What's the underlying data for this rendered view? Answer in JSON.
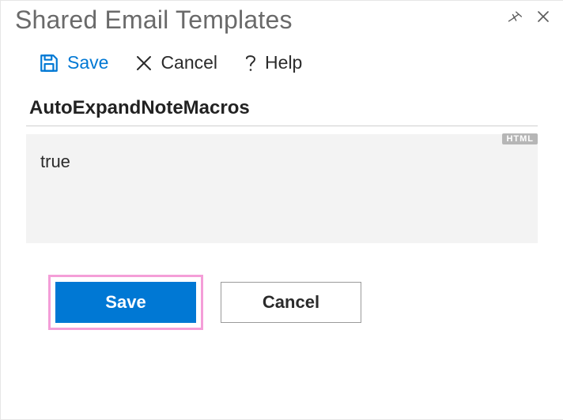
{
  "title": "Shared Email Templates",
  "toolbar": {
    "save_label": "Save",
    "cancel_label": "Cancel",
    "help_label": "Help"
  },
  "field": {
    "name": "AutoExpandNoteMacros",
    "html_badge": "HTML",
    "value": "true"
  },
  "footer": {
    "save_label": "Save",
    "cancel_label": "Cancel"
  },
  "colors": {
    "accent": "#0078d4",
    "highlight": "#f49ed8"
  }
}
